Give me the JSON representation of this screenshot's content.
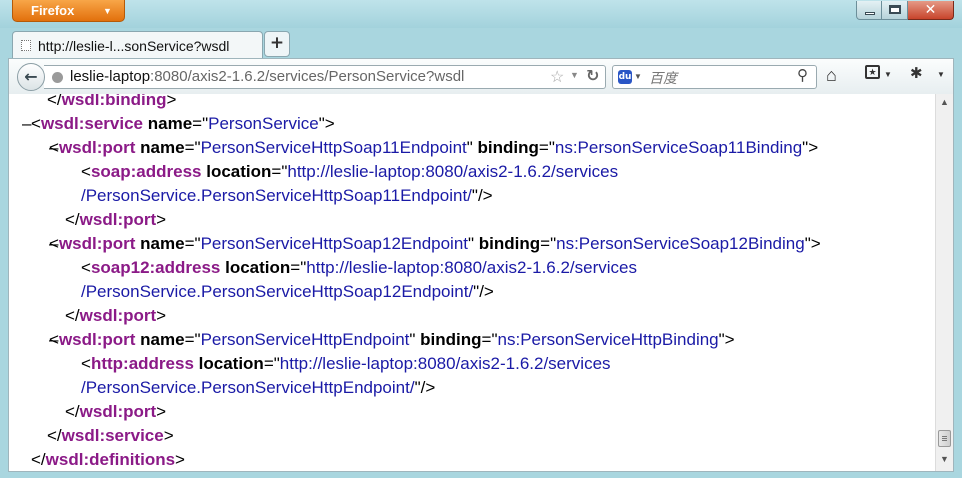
{
  "window": {
    "app_button_label": "Firefox",
    "app_button_arrow": "▼",
    "minimize_icon": "minimize-icon",
    "maximize_icon": "maximize-icon",
    "close_glyph": "✕"
  },
  "tabs": [
    {
      "label": "http://leslie-l...sonService?wsdl",
      "icon": "blank-page-icon"
    }
  ],
  "new_tab_label": "+",
  "nav": {
    "back_glyph": "←",
    "url_host": "leslie-laptop",
    "url_rest": ":8080/axis2-1.6.2/services/PersonService?wsdl",
    "bookmark_star_glyph": "☆",
    "url_dropdown_glyph": "▼",
    "reload_glyph": "↻",
    "search_engine_glyph": "du",
    "search_engine_dropdown_glyph": "▼",
    "search_placeholder": "百度",
    "search_glyph": "⚲",
    "home_glyph": "⌂",
    "bookmarks_glyph": "★",
    "bookmarks_dropdown_glyph": "▼",
    "tools_glyph": "✱",
    "tools_dropdown_glyph": "▼"
  },
  "xml_lines": [
    {
      "toggle": "",
      "parts": [
        {
          "t": "p",
          "v": "</"
        },
        {
          "t": "tag",
          "v": "wsdl:binding"
        },
        {
          "t": "p",
          "v": ">"
        }
      ]
    },
    {
      "toggle": "–",
      "parts": [
        {
          "t": "p",
          "v": "<"
        },
        {
          "t": "tag",
          "v": "wsdl:service"
        },
        {
          "t": "p",
          "v": " "
        },
        {
          "t": "an",
          "v": "name"
        },
        {
          "t": "p",
          "v": "=\""
        },
        {
          "t": "av",
          "v": "PersonService"
        },
        {
          "t": "p",
          "v": "\">"
        }
      ]
    },
    {
      "toggle": "–",
      "parts": [
        {
          "t": "p",
          "v": "<"
        },
        {
          "t": "tag",
          "v": "wsdl:port"
        },
        {
          "t": "p",
          "v": " "
        },
        {
          "t": "an",
          "v": "name"
        },
        {
          "t": "p",
          "v": "=\""
        },
        {
          "t": "av",
          "v": "PersonServiceHttpSoap11Endpoint"
        },
        {
          "t": "p",
          "v": "\" "
        },
        {
          "t": "an",
          "v": "binding"
        },
        {
          "t": "p",
          "v": "=\""
        },
        {
          "t": "av",
          "v": "ns:PersonServiceSoap11Binding"
        },
        {
          "t": "p",
          "v": "\">"
        }
      ]
    },
    {
      "toggle": "",
      "parts": [
        {
          "t": "p",
          "v": "<"
        },
        {
          "t": "tag",
          "v": "soap:address"
        },
        {
          "t": "p",
          "v": " "
        },
        {
          "t": "an",
          "v": "location"
        },
        {
          "t": "p",
          "v": "=\""
        },
        {
          "t": "av",
          "v": "http://leslie-laptop:8080/axis2-1.6.2/services"
        }
      ]
    },
    {
      "toggle": "",
      "parts": [
        {
          "t": "av",
          "v": "/PersonService.PersonServiceHttpSoap11Endpoint/"
        },
        {
          "t": "p",
          "v": "\"/>"
        }
      ]
    },
    {
      "toggle": "",
      "parts": [
        {
          "t": "p",
          "v": "</"
        },
        {
          "t": "tag",
          "v": "wsdl:port"
        },
        {
          "t": "p",
          "v": ">"
        }
      ]
    },
    {
      "toggle": "–",
      "parts": [
        {
          "t": "p",
          "v": "<"
        },
        {
          "t": "tag",
          "v": "wsdl:port"
        },
        {
          "t": "p",
          "v": " "
        },
        {
          "t": "an",
          "v": "name"
        },
        {
          "t": "p",
          "v": "=\""
        },
        {
          "t": "av",
          "v": "PersonServiceHttpSoap12Endpoint"
        },
        {
          "t": "p",
          "v": "\" "
        },
        {
          "t": "an",
          "v": "binding"
        },
        {
          "t": "p",
          "v": "=\""
        },
        {
          "t": "av",
          "v": "ns:PersonServiceSoap12Binding"
        },
        {
          "t": "p",
          "v": "\">"
        }
      ]
    },
    {
      "toggle": "",
      "parts": [
        {
          "t": "p",
          "v": "<"
        },
        {
          "t": "tag",
          "v": "soap12:address"
        },
        {
          "t": "p",
          "v": " "
        },
        {
          "t": "an",
          "v": "location"
        },
        {
          "t": "p",
          "v": "=\""
        },
        {
          "t": "av",
          "v": "http://leslie-laptop:8080/axis2-1.6.2/services"
        }
      ]
    },
    {
      "toggle": "",
      "parts": [
        {
          "t": "av",
          "v": "/PersonService.PersonServiceHttpSoap12Endpoint/"
        },
        {
          "t": "p",
          "v": "\"/>"
        }
      ]
    },
    {
      "toggle": "",
      "parts": [
        {
          "t": "p",
          "v": "</"
        },
        {
          "t": "tag",
          "v": "wsdl:port"
        },
        {
          "t": "p",
          "v": ">"
        }
      ]
    },
    {
      "toggle": "–",
      "parts": [
        {
          "t": "p",
          "v": "<"
        },
        {
          "t": "tag",
          "v": "wsdl:port"
        },
        {
          "t": "p",
          "v": " "
        },
        {
          "t": "an",
          "v": "name"
        },
        {
          "t": "p",
          "v": "=\""
        },
        {
          "t": "av",
          "v": "PersonServiceHttpEndpoint"
        },
        {
          "t": "p",
          "v": "\" "
        },
        {
          "t": "an",
          "v": "binding"
        },
        {
          "t": "p",
          "v": "=\""
        },
        {
          "t": "av",
          "v": "ns:PersonServiceHttpBinding"
        },
        {
          "t": "p",
          "v": "\">"
        }
      ]
    },
    {
      "toggle": "",
      "parts": [
        {
          "t": "p",
          "v": "<"
        },
        {
          "t": "tag",
          "v": "http:address"
        },
        {
          "t": "p",
          "v": " "
        },
        {
          "t": "an",
          "v": "location"
        },
        {
          "t": "p",
          "v": "=\""
        },
        {
          "t": "av",
          "v": "http://leslie-laptop:8080/axis2-1.6.2/services"
        }
      ]
    },
    {
      "toggle": "",
      "parts": [
        {
          "t": "av",
          "v": "/PersonService.PersonServiceHttpEndpoint/"
        },
        {
          "t": "p",
          "v": "\"/>"
        }
      ]
    },
    {
      "toggle": "",
      "parts": [
        {
          "t": "p",
          "v": "</"
        },
        {
          "t": "tag",
          "v": "wsdl:port"
        },
        {
          "t": "p",
          "v": ">"
        }
      ]
    },
    {
      "toggle": "",
      "parts": [
        {
          "t": "p",
          "v": "</"
        },
        {
          "t": "tag",
          "v": "wsdl:service"
        },
        {
          "t": "p",
          "v": ">"
        }
      ]
    },
    {
      "toggle": "",
      "parts": [
        {
          "t": "p",
          "v": "</"
        },
        {
          "t": "tag",
          "v": "wsdl:definitions"
        },
        {
          "t": "p",
          "v": ">"
        }
      ]
    }
  ],
  "scrollbar": {
    "up_glyph": "▲",
    "down_glyph": "▼"
  },
  "colors": {
    "tag": "#8b1a87",
    "attr_name": "#000000",
    "attr_value": "#1a1aa6",
    "window_frame": "#a9d6df"
  }
}
